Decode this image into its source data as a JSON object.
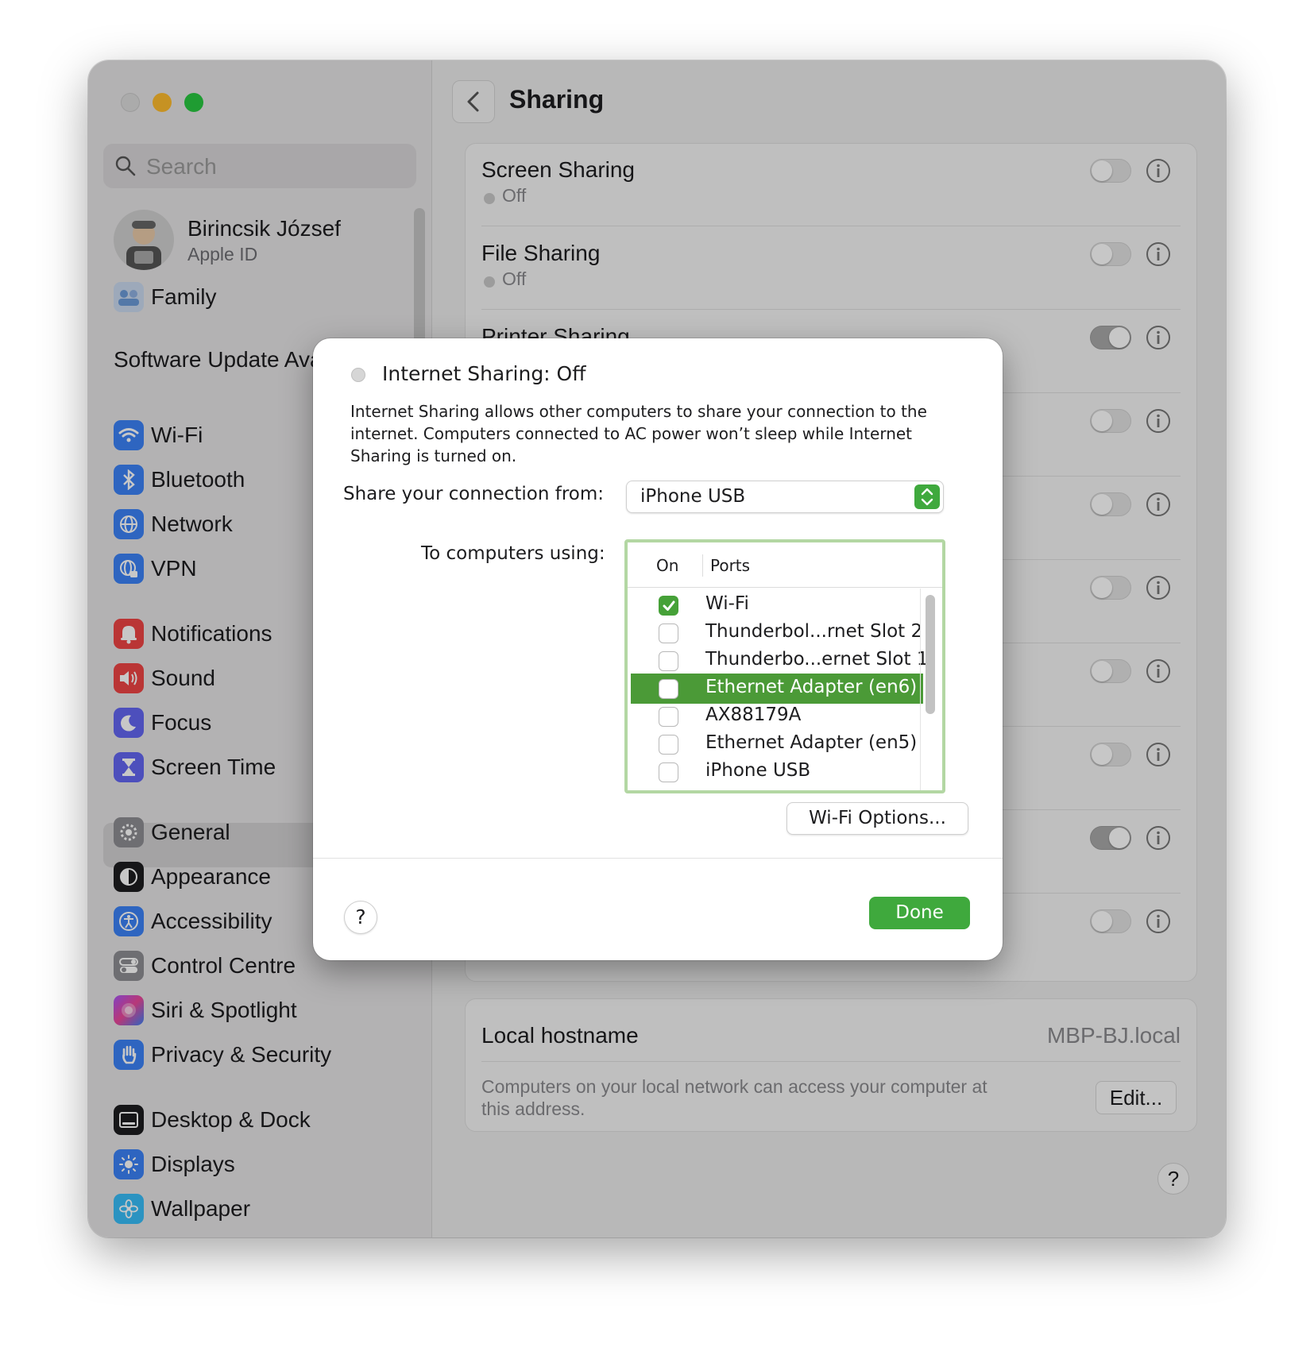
{
  "sidebar": {
    "search_placeholder": "Search",
    "profile": {
      "name": "Birincsik József",
      "subtitle": "Apple ID"
    },
    "family_label": "Family",
    "software_update": "Software Update Available",
    "items": [
      {
        "label": "Wi-Fi",
        "icon": "wifi-icon",
        "color": "#3b82f6"
      },
      {
        "label": "Bluetooth",
        "icon": "bluetooth-icon",
        "color": "#3b82f6"
      },
      {
        "label": "Network",
        "icon": "globe-icon",
        "color": "#3b82f6"
      },
      {
        "label": "VPN",
        "icon": "vpn-globe-icon",
        "color": "#3b82f6"
      },
      {
        "label": "Notifications",
        "icon": "bell-icon",
        "color": "#ef4444"
      },
      {
        "label": "Sound",
        "icon": "speaker-icon",
        "color": "#ef4444"
      },
      {
        "label": "Focus",
        "icon": "moon-icon",
        "color": "#6366f1"
      },
      {
        "label": "Screen Time",
        "icon": "hourglass-icon",
        "color": "#6366f1"
      },
      {
        "label": "General",
        "icon": "gear-icon",
        "color": "#8e8e93"
      },
      {
        "label": "Appearance",
        "icon": "appearance-icon",
        "color": "#1d1d1f"
      },
      {
        "label": "Accessibility",
        "icon": "accessibility-icon",
        "color": "#3b82f6"
      },
      {
        "label": "Control Centre",
        "icon": "switches-icon",
        "color": "#8e8e93"
      },
      {
        "label": "Siri & Spotlight",
        "icon": "siri-icon",
        "color": "#a855f7"
      },
      {
        "label": "Privacy & Security",
        "icon": "hand-icon",
        "color": "#3b82f6"
      },
      {
        "label": "Desktop & Dock",
        "icon": "dock-icon",
        "color": "#1d1d1f"
      },
      {
        "label": "Displays",
        "icon": "sun-icon",
        "color": "#3b82f6"
      },
      {
        "label": "Wallpaper",
        "icon": "flower-icon",
        "color": "#38bdf8"
      }
    ]
  },
  "main": {
    "title": "Sharing",
    "rows": [
      {
        "title": "Screen Sharing",
        "status": "Off"
      },
      {
        "title": "File Sharing",
        "status": "Off"
      },
      {
        "title": "Printer Sharing"
      }
    ],
    "hostname": {
      "label": "Local hostname",
      "value": "MBP-BJ.local",
      "description": "Computers on your local network can access your computer at this address.",
      "edit_label": "Edit..."
    },
    "help": "?"
  },
  "dialog": {
    "title": "Internet Sharing: Off",
    "description": "Internet Sharing allows other computers to share your connection to the internet. Computers connected to AC power won’t sleep while Internet Sharing is turned on.",
    "share_label": "Share your connection from:",
    "share_value": "iPhone USB",
    "to_label": "To computers using:",
    "table": {
      "col_on": "On",
      "col_ports": "Ports",
      "ports": [
        {
          "label": "Wi-Fi",
          "checked": true
        },
        {
          "label": "Thunderbol...rnet Slot 2",
          "checked": false
        },
        {
          "label": "Thunderbo...ernet Slot 1",
          "checked": false
        },
        {
          "label": "Ethernet Adapter (en6)",
          "checked": false,
          "selected": true
        },
        {
          "label": "AX88179A",
          "checked": false
        },
        {
          "label": "Ethernet Adapter (en5)",
          "checked": false
        },
        {
          "label": "iPhone USB",
          "checked": false
        }
      ]
    },
    "wifi_options": "Wi-Fi Options...",
    "help": "?",
    "done": "Done"
  }
}
